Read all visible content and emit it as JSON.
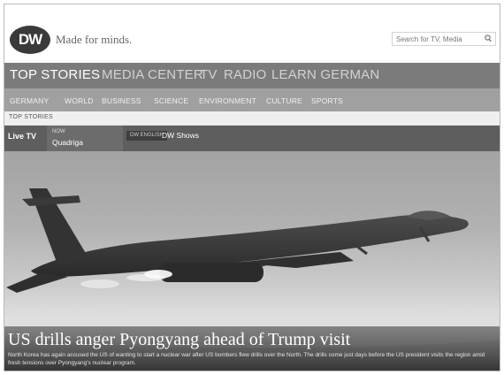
{
  "header": {
    "logo_text": "DW",
    "slogan": "Made for minds.",
    "search_placeholder": "Search for TV, Media"
  },
  "top_nav": {
    "items": [
      {
        "label": "TOP STORIES",
        "active": true
      },
      {
        "label": "MEDIA CENTER",
        "active": false
      },
      {
        "label": "TV",
        "active": false
      },
      {
        "label": "RADIO",
        "active": false
      },
      {
        "label": "LEARN GERMAN",
        "active": false
      }
    ]
  },
  "sub_nav": {
    "items": [
      "GERMANY",
      "WORLD",
      "BUSINESS",
      "SCIENCE",
      "ENVIRONMENT",
      "CULTURE",
      "SPORTS"
    ]
  },
  "breadcrumb": "TOP STORIES",
  "live_bar": {
    "label": "Live TV",
    "now_label": "NOW",
    "now_title": "Quadriga",
    "tag": "DW ENGLISH",
    "channel": "DW Shows"
  },
  "hero": {
    "headline": "US drills anger Pyongyang ahead of Trump visit",
    "teaser": "North Korea has again accused the US of wanting to start a nuclear war after US bombers flew drills over the North. The drills come just days before the US president visits the region amid fresh tensions over Pyongyang's nuclear program."
  },
  "colors": {
    "top_nav_bg": "#7b7b7b",
    "sub_nav_bg": "#a0a0a0",
    "live_bar_bg": "#5e5e5e",
    "logo_bg": "#3a3a3a"
  }
}
